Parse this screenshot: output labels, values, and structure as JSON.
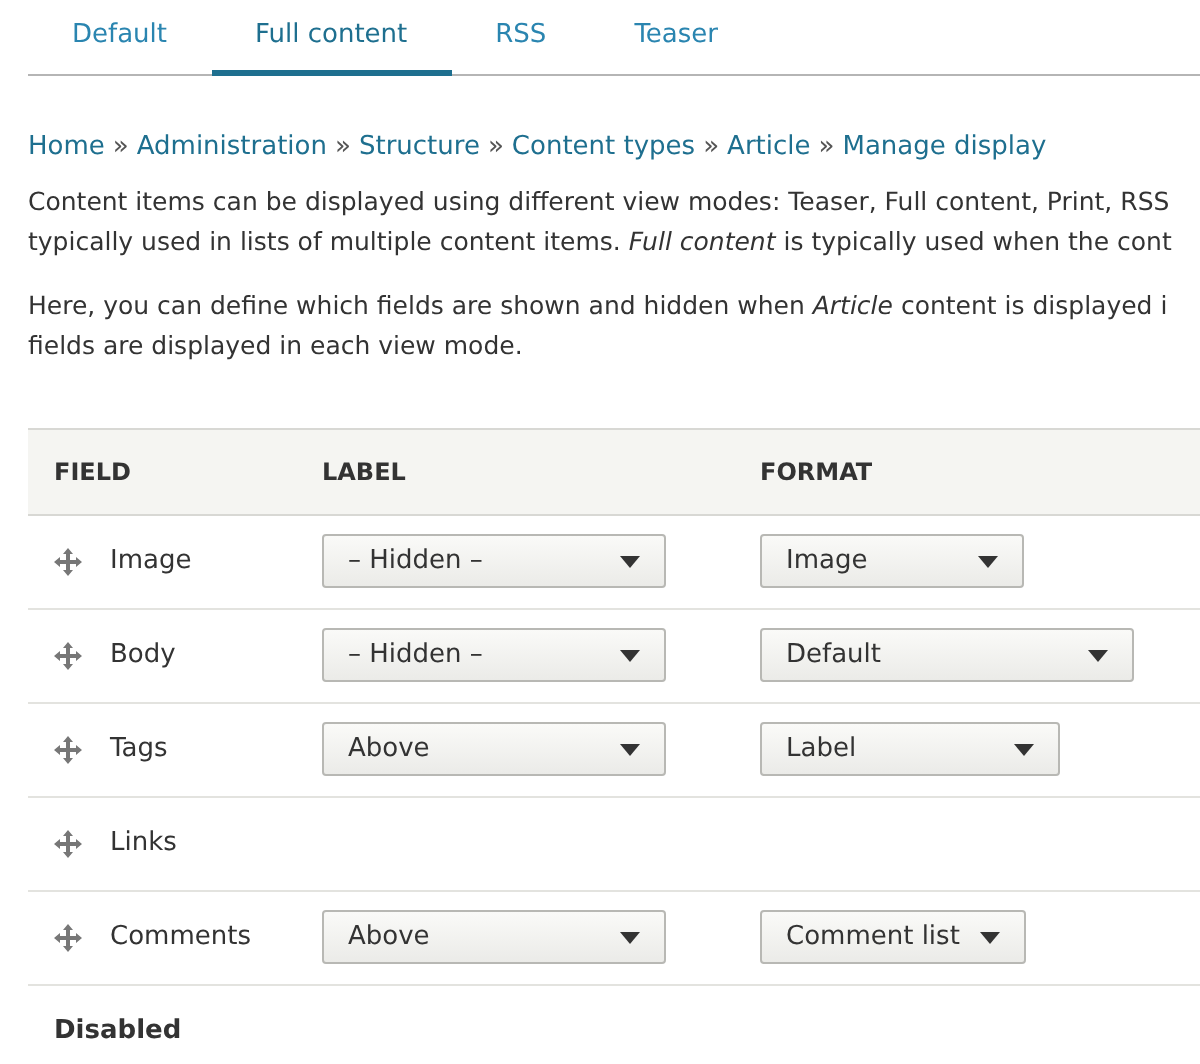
{
  "tabs": [
    {
      "label": "Default",
      "selected": false
    },
    {
      "label": "Full content",
      "selected": true
    },
    {
      "label": "RSS",
      "selected": false
    },
    {
      "label": "Teaser",
      "selected": false
    }
  ],
  "breadcrumb": {
    "separator": "»",
    "items": [
      "Home",
      "Administration",
      "Structure",
      "Content types",
      "Article",
      "Manage display"
    ]
  },
  "paragraphs": [
    {
      "lines": [
        "Content items can be displayed using different view modes: Teaser, Full content, Print, RSS",
        "typically used in lists of multiple content items. *Full content* is typically used when the cont"
      ]
    },
    {
      "lines": [
        "Here, you can define which fields are shown and hidden when *Article* content is displayed i",
        "fields are displayed in each view mode."
      ]
    }
  ],
  "table": {
    "columns": [
      "FIELD",
      "LABEL",
      "FORMAT"
    ],
    "rows": [
      {
        "kind": "field",
        "field": "Image",
        "label": "– Hidden –",
        "format": "Image"
      },
      {
        "kind": "field",
        "field": "Body",
        "label": "– Hidden –",
        "format": "Default"
      },
      {
        "kind": "field",
        "field": "Tags",
        "label": "Above",
        "format": "Label"
      },
      {
        "kind": "field",
        "field": "Links"
      },
      {
        "kind": "field",
        "field": "Comments",
        "label": "Above",
        "format": "Comment list"
      },
      {
        "kind": "region",
        "field": "Disabled"
      }
    ]
  }
}
